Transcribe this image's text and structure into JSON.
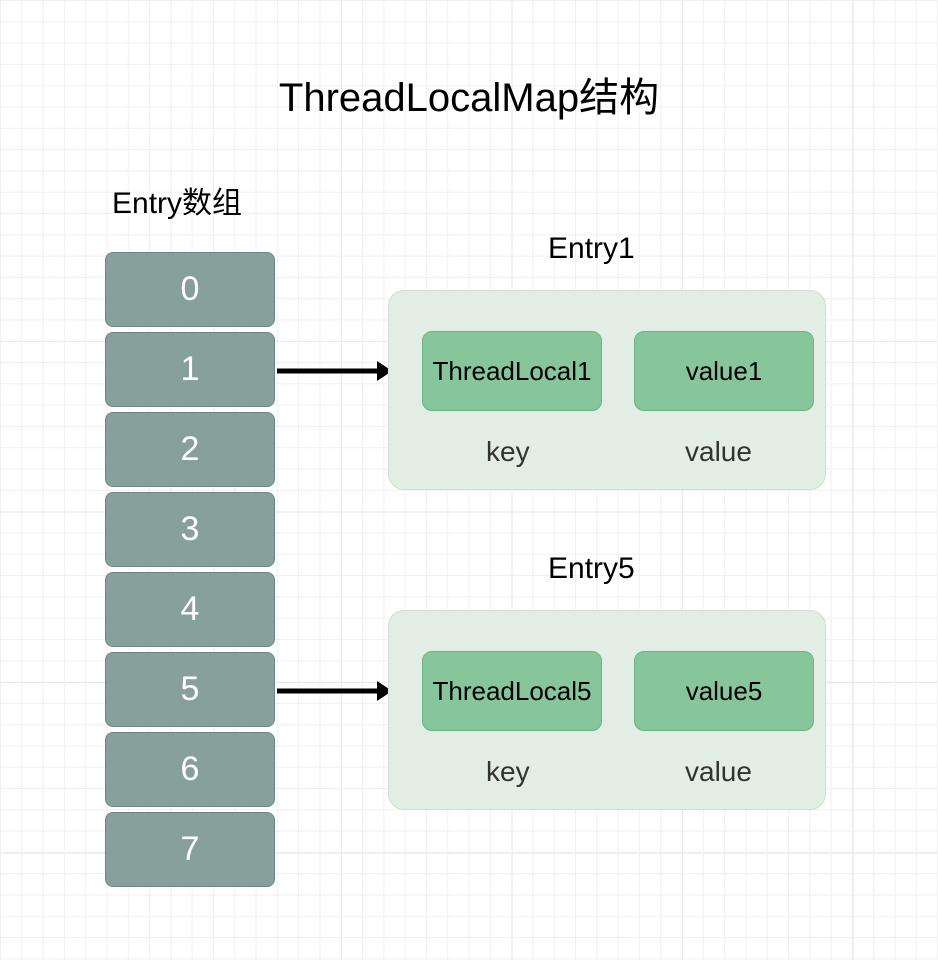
{
  "title": "ThreadLocalMap结构",
  "array_label": "Entry数组",
  "cells": [
    "0",
    "1",
    "2",
    "3",
    "4",
    "5",
    "6",
    "7"
  ],
  "entry1": {
    "title": "Entry1",
    "key": "ThreadLocal1",
    "value": "value1",
    "key_label": "key",
    "value_label": "value"
  },
  "entry5": {
    "title": "Entry5",
    "key": "ThreadLocal5",
    "value": "value5",
    "key_label": "key",
    "value_label": "value"
  }
}
